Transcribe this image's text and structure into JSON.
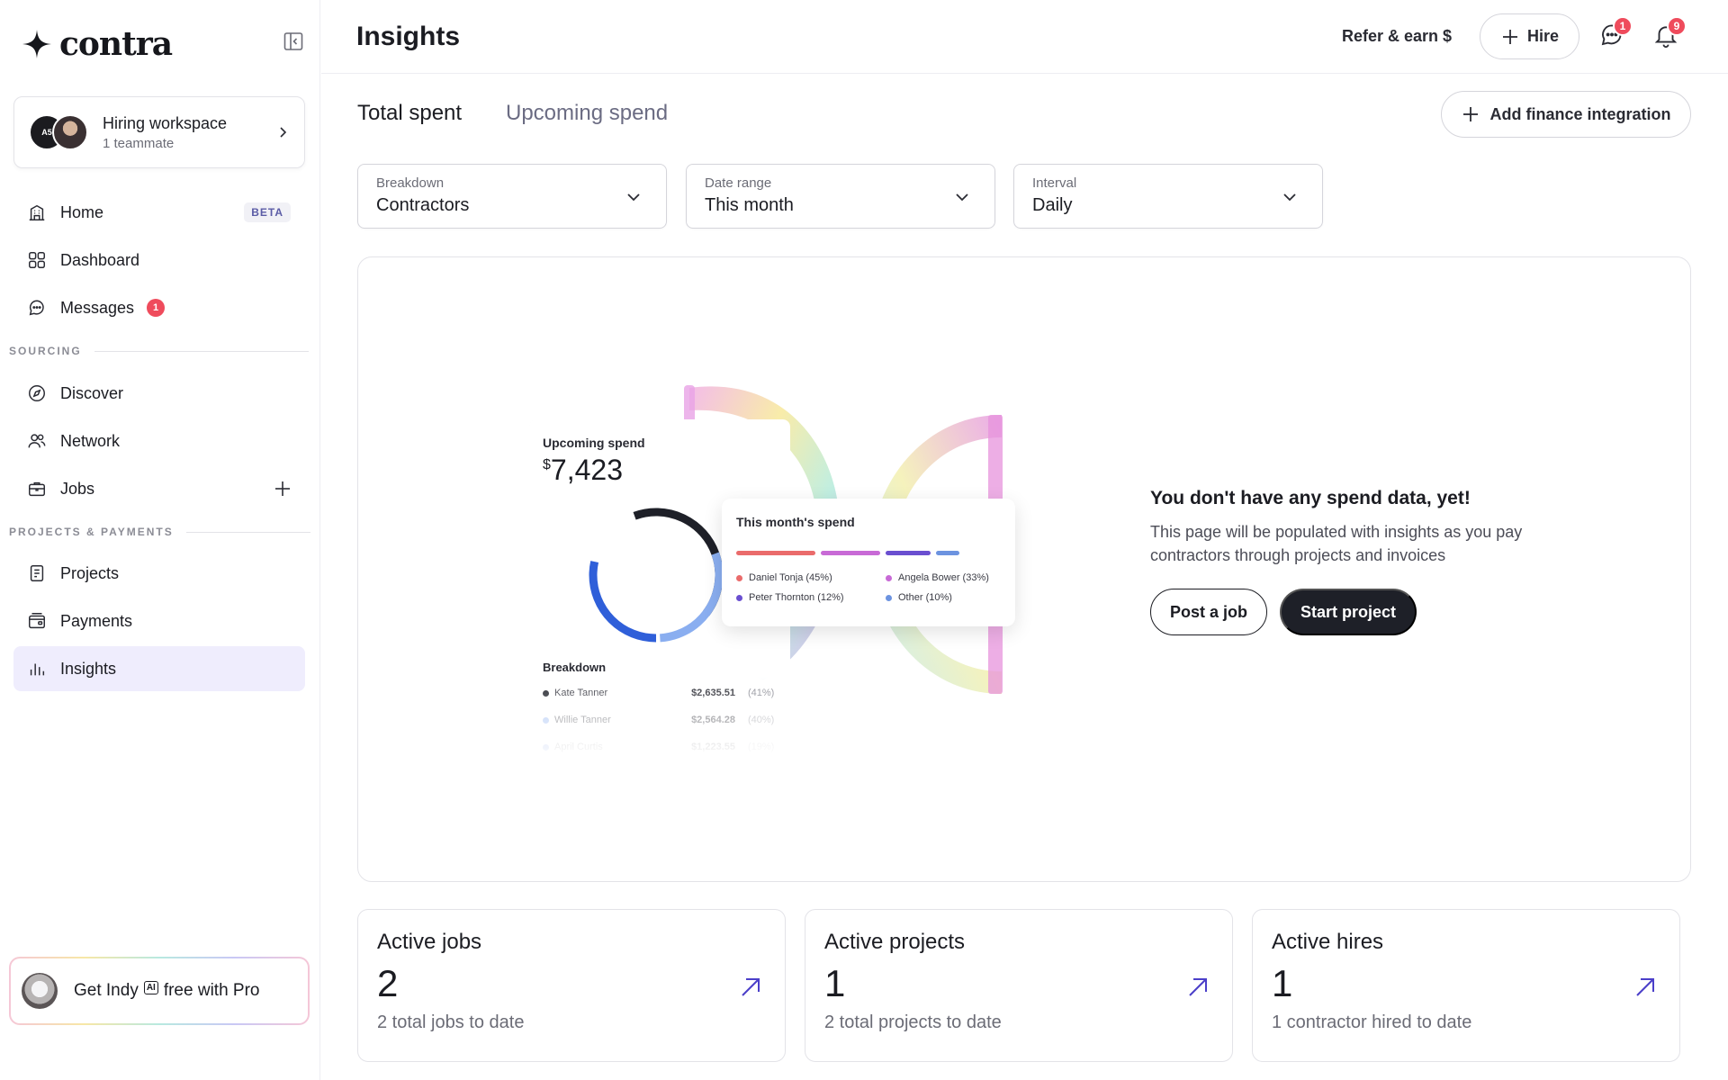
{
  "brand": {
    "name": "contra"
  },
  "workspace": {
    "title": "Hiring workspace",
    "subtitle": "1 teammate"
  },
  "sidebar": {
    "items": [
      {
        "label": "Home",
        "badge": "BETA"
      },
      {
        "label": "Dashboard"
      },
      {
        "label": "Messages",
        "count": "1"
      },
      {
        "label": "Discover"
      },
      {
        "label": "Network"
      },
      {
        "label": "Jobs"
      },
      {
        "label": "Projects"
      },
      {
        "label": "Payments"
      },
      {
        "label": "Insights"
      }
    ],
    "sections": {
      "sourcing": "SOURCING",
      "projects": "PROJECTS & PAYMENTS"
    },
    "promo": {
      "get": "Get Indy",
      "ai": "AI",
      "rest": "free with Pro"
    }
  },
  "header": {
    "title": "Insights",
    "refer": "Refer & earn $",
    "hire": "Hire",
    "messages_count": "1",
    "notifications_count": "9"
  },
  "tabs": {
    "total": "Total spent",
    "upcoming": "Upcoming spend"
  },
  "finance_button": "Add finance integration",
  "filters": {
    "breakdown": {
      "label": "Breakdown",
      "value": "Contractors"
    },
    "date_range": {
      "label": "Date range",
      "value": "This month"
    },
    "interval": {
      "label": "Interval",
      "value": "Daily"
    }
  },
  "illustration": {
    "upcoming_title": "Upcoming spend",
    "currency": "$",
    "amount": "7,423",
    "breakdown_title": "Breakdown",
    "rows": [
      {
        "name": "Kate Tanner",
        "amount": "$2,635.51",
        "pct": "(41%)",
        "color": "#1e2028"
      },
      {
        "name": "Willie Tanner",
        "amount": "$2,564.28",
        "pct": "(40%)",
        "color": "#8aaef0"
      },
      {
        "name": "April Curtis",
        "amount": "$1,223.55",
        "pct": "(19%)",
        "color": "#2f5fd9"
      }
    ],
    "month_title": "This month's spend",
    "legend": [
      {
        "name": "Daniel Tonja (45%)",
        "color": "#ea6b6b"
      },
      {
        "name": "Angela Bower (33%)",
        "color": "#c86ad6"
      },
      {
        "name": "Peter Thornton (12%)",
        "color": "#6a4fd0"
      },
      {
        "name": "Other (10%)",
        "color": "#6c93e0"
      }
    ]
  },
  "empty": {
    "title": "You don't have any spend data, yet!",
    "desc": "This page will be populated with insights as you pay contractors through projects and invoices",
    "post_job": "Post a job",
    "start_project": "Start project"
  },
  "stats": [
    {
      "title": "Active jobs",
      "value": "2",
      "sub": "2 total jobs to date"
    },
    {
      "title": "Active projects",
      "value": "1",
      "sub": "2 total projects to date"
    },
    {
      "title": "Active hires",
      "value": "1",
      "sub": "1 contractor hired to date"
    }
  ]
}
